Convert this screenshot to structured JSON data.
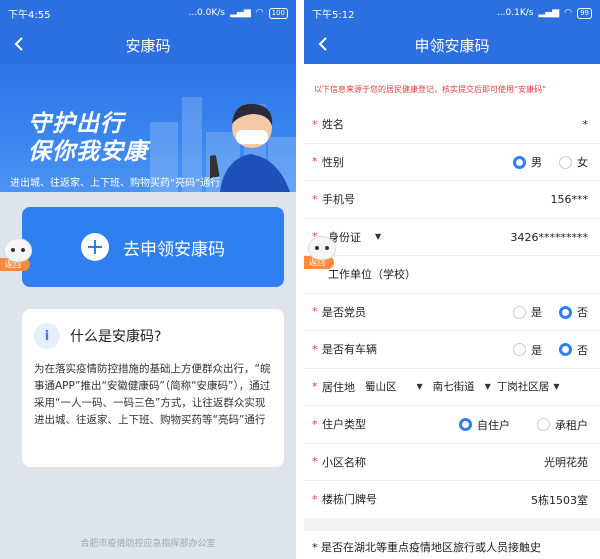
{
  "left": {
    "status": {
      "time": "下午4:55",
      "speed": "...0.0K/s",
      "battery": "100"
    },
    "title": "安康码",
    "banner": {
      "line1": "守护出行",
      "line2": "保你我安康",
      "sub": "进出城、往返家、上下班、购物买药“亮码”通行"
    },
    "apply_label": "去申领安康码",
    "mascot_tag": "返回",
    "info": {
      "title": "什么是安康码?",
      "body": "为在落实疫情防控措施的基础上方便群众出行，“皖事通APP”推出“安徽健康码”（简称“安康码”），通过采用“一人一码、一码三色”方式，让往返群众实现进出城、往返家、上下班、购物买药等“亮码”通行"
    },
    "footer": "合肥市疫情防控应急指挥部办公室"
  },
  "right": {
    "status": {
      "time": "下午5:12",
      "speed": "...0.1K/s",
      "battery": "99"
    },
    "title": "申领安康码",
    "notice": "以下信息来源于您的居民健康登记，核实提交后即可使用“安康码”",
    "mascot_tag": "返回",
    "fields": {
      "name": {
        "label": "姓名",
        "value": "*"
      },
      "gender": {
        "label": "性别",
        "opt_male": "男",
        "opt_female": "女"
      },
      "phone": {
        "label": "手机号",
        "value": "156***"
      },
      "idcard": {
        "label": "身份证",
        "value": "3426*********"
      },
      "workplace": {
        "label": "工作单位（学校）",
        "value": ""
      },
      "party": {
        "label": "是否党员",
        "opt_yes": "是",
        "opt_no": "否"
      },
      "vehicle": {
        "label": "是否有车辆",
        "opt_yes": "是",
        "opt_no": "否"
      },
      "residence": {
        "label": "居住地",
        "district": "蜀山区",
        "street": "南七街道",
        "community": "丁岗社区居"
      },
      "resident_type": {
        "label": "住户类型",
        "opt_self": "自住户",
        "opt_rent": "承租户"
      },
      "community_name": {
        "label": "小区名称",
        "value": "光明花苑"
      },
      "building": {
        "label": "楼栋门牌号",
        "value": "5栋1503室"
      }
    },
    "cut_text": "* 是否在湖北等重点疫情地区旅行或人员接触史"
  },
  "colors": {
    "primary": "#2b6fe0",
    "accent": "#2f7ff0",
    "required": "#e04141",
    "tag": "#ff8a3d"
  }
}
